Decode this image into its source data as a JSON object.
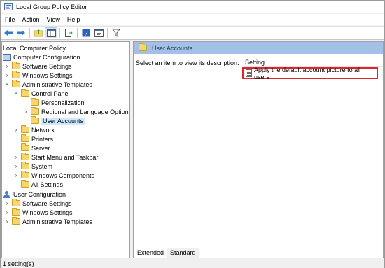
{
  "window": {
    "title": "Local Group Policy Editor"
  },
  "menu": [
    "File",
    "Action",
    "View",
    "Help"
  ],
  "toolbar": {
    "buttons": [
      "back-icon",
      "forward-icon",
      "up-folder-icon",
      "show-hide-tree-icon",
      "export-list-icon",
      "help-icon",
      "properties-icon",
      "filter-icon"
    ]
  },
  "tree": {
    "items": [
      {
        "label": "Local Computer Policy",
        "level": 0,
        "icon": "none",
        "expander": ""
      },
      {
        "label": "Computer Configuration",
        "level": 0,
        "icon": "computer-icon",
        "expander": ""
      },
      {
        "label": "Software Settings",
        "level": 1,
        "icon": "folder-icon",
        "expander": "›"
      },
      {
        "label": "Windows Settings",
        "level": 1,
        "icon": "folder-icon",
        "expander": "›"
      },
      {
        "label": "Administrative Templates",
        "level": 1,
        "icon": "folder-icon",
        "expander": "˅"
      },
      {
        "label": "Control Panel",
        "level": 2,
        "icon": "folder-icon",
        "expander": "˅"
      },
      {
        "label": "Personalization",
        "level": 3,
        "icon": "folder-icon",
        "expander": ""
      },
      {
        "label": "Regional and Language Options",
        "level": 3,
        "icon": "folder-icon",
        "expander": "›"
      },
      {
        "label": "User Accounts",
        "level": 3,
        "icon": "folder-icon",
        "expander": "",
        "selected": true
      },
      {
        "label": "Network",
        "level": 2,
        "icon": "folder-icon",
        "expander": "›"
      },
      {
        "label": "Printers",
        "level": 2,
        "icon": "folder-icon",
        "expander": ""
      },
      {
        "label": "Server",
        "level": 2,
        "icon": "folder-icon",
        "expander": ""
      },
      {
        "label": "Start Menu and Taskbar",
        "level": 2,
        "icon": "folder-icon",
        "expander": "›"
      },
      {
        "label": "System",
        "level": 2,
        "icon": "folder-icon",
        "expander": "›"
      },
      {
        "label": "Windows Components",
        "level": 2,
        "icon": "folder-icon",
        "expander": "›"
      },
      {
        "label": "All Settings",
        "level": 2,
        "icon": "folder-icon",
        "expander": ""
      },
      {
        "label": "User Configuration",
        "level": 0,
        "icon": "user-icon",
        "expander": ""
      },
      {
        "label": "Software Settings",
        "level": 1,
        "icon": "folder-icon",
        "expander": "›"
      },
      {
        "label": "Windows Settings",
        "level": 1,
        "icon": "folder-icon",
        "expander": "›"
      },
      {
        "label": "Administrative Templates",
        "level": 1,
        "icon": "folder-icon",
        "expander": "›"
      }
    ]
  },
  "right": {
    "header": "User Accounts",
    "description": "Select an item to view its description.",
    "column_header": "Setting",
    "settings": [
      "Apply the default account picture to all users"
    ],
    "highlight_color": "#e0242a"
  },
  "tabs": [
    "Extended",
    "Standard"
  ],
  "status": "1 setting(s)",
  "colors": {
    "header_bg": "#a3c1e6",
    "selection": "#cce8ff"
  }
}
